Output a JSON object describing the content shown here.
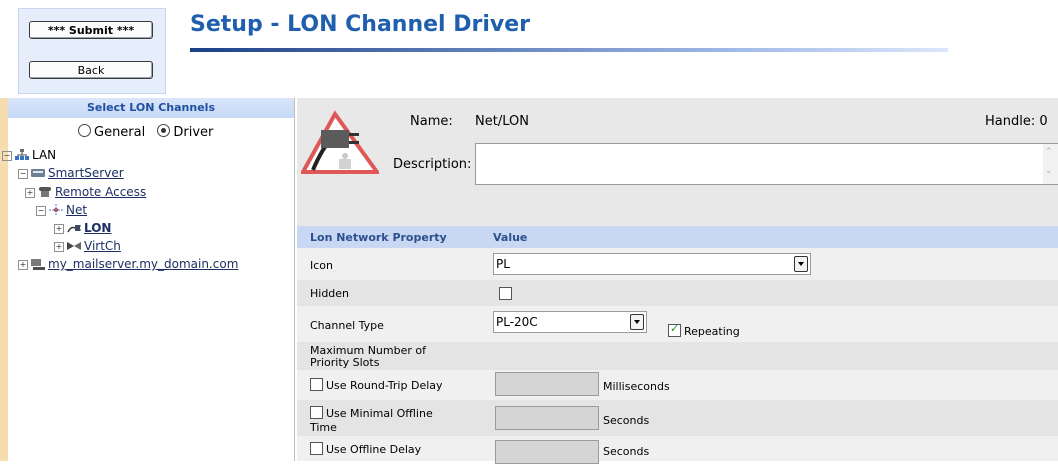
{
  "header": {
    "submit_label": "*** Submit ***",
    "back_label": "Back",
    "title": "Setup - LON Channel Driver"
  },
  "left_panel": {
    "heading": "Select LON Channels",
    "radio_general": "General",
    "radio_driver": "Driver",
    "selected_radio": "Driver",
    "tree": {
      "lan": "LAN",
      "smartserver": "SmartServer",
      "remote_access": "Remote Access",
      "net": "Net",
      "lon": "LON",
      "virtch": "VirtCh",
      "mailserver": "my_mailserver.my_domain.com"
    }
  },
  "detail": {
    "name_label": "Name:",
    "name_value": "Net/LON",
    "handle_label": "Handle: 0",
    "description_label": "Description:",
    "description_value": ""
  },
  "properties": {
    "col_property": "Lon Network Property",
    "col_value": "Value",
    "icon_label": "Icon",
    "icon_value": "PL",
    "hidden_label": "Hidden",
    "hidden_checked": false,
    "channel_type_label": "Channel Type",
    "channel_type_value": "PL-20C",
    "repeating_label": "Repeating",
    "repeating_checked": true,
    "max_priority_label_1": "Maximum Number of",
    "max_priority_label_2": "Priority Slots",
    "round_trip_label": "Use Round-Trip Delay",
    "round_trip_unit": "Milliseconds",
    "minimal_offline_label_1": "Use Minimal Offline",
    "minimal_offline_label_2": "Time",
    "minimal_offline_unit": "Seconds",
    "offline_delay_label": "Use Offline Delay",
    "offline_delay_unit": "Seconds"
  }
}
